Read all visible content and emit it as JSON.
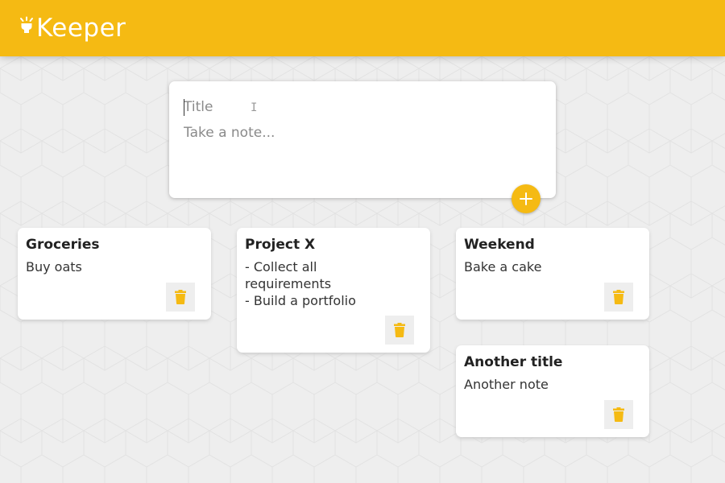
{
  "header": {
    "app_title": "Keeper",
    "icon": "lightbulb-icon"
  },
  "create_note": {
    "title_placeholder": "Title",
    "content_placeholder": "Take a note...",
    "title_value": "",
    "content_value": "",
    "add_icon": "plus-icon"
  },
  "notes": [
    {
      "title": "Groceries",
      "content": "Buy oats",
      "delete_icon": "trash-icon"
    },
    {
      "title": "Project X",
      "content": "- Collect all\nrequirements\n- Build a portfolio",
      "delete_icon": "trash-icon"
    },
    {
      "title": "Weekend",
      "content": "Bake a cake",
      "delete_icon": "trash-icon"
    },
    {
      "title": "Another title",
      "content": "Another note",
      "delete_icon": "trash-icon"
    }
  ],
  "colors": {
    "accent": "#f5ba13",
    "background": "#eeeeee",
    "card": "#ffffff"
  }
}
